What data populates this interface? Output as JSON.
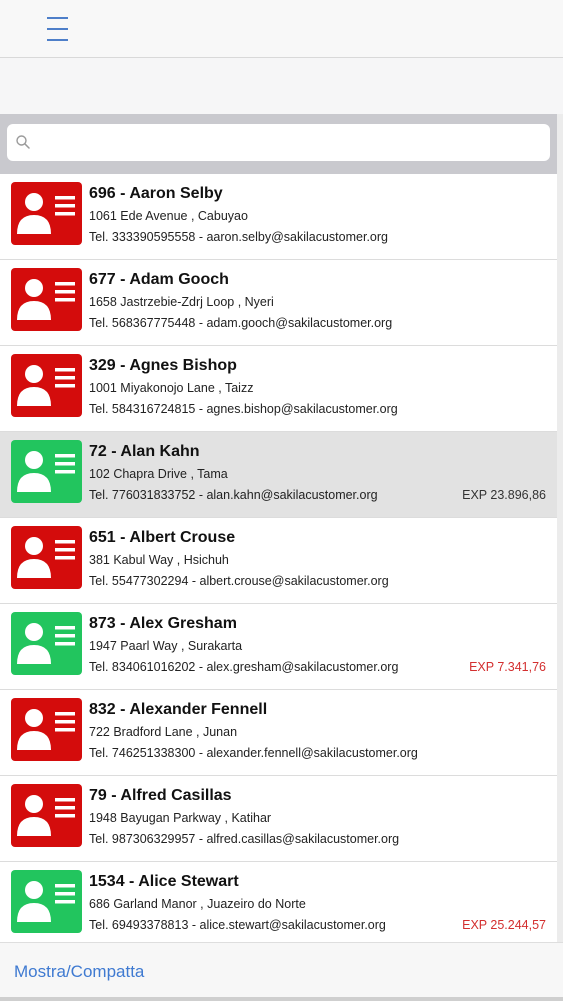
{
  "nav": {
    "menu_icon": "hamburger-menu-icon",
    "accent": "#4e7fc9"
  },
  "search": {
    "value": "",
    "placeholder": "",
    "icon": "search-icon"
  },
  "colors": {
    "badge_red": "#d40c0c",
    "badge_green": "#22c55e",
    "exp_gray": "#333333",
    "exp_red": "#d32f2f",
    "link_blue": "#3f7ad1"
  },
  "customers": [
    {
      "name": "696 - Aaron Selby",
      "address": "1061 Ede Avenue , Cabuyao",
      "contact": "Tel. 333390595558 - aaron.selby@sakilacustomer.org",
      "status": "red",
      "exp": "",
      "exp_color": "",
      "selected": false
    },
    {
      "name": "677 - Adam Gooch",
      "address": "1658 Jastrzebie-Zdrj Loop , Nyeri",
      "contact": "Tel. 568367775448 - adam.gooch@sakilacustomer.org",
      "status": "red",
      "exp": "",
      "exp_color": "",
      "selected": false
    },
    {
      "name": "329 - Agnes Bishop",
      "address": "1001 Miyakonojo Lane , Taizz",
      "contact": "Tel. 584316724815 - agnes.bishop@sakilacustomer.org",
      "status": "red",
      "exp": "",
      "exp_color": "",
      "selected": false
    },
    {
      "name": "72 - Alan Kahn",
      "address": "102 Chapra Drive , Tama",
      "contact": "Tel. 776031833752 - alan.kahn@sakilacustomer.org",
      "status": "green",
      "exp": "EXP 23.896,86",
      "exp_color": "#333333",
      "selected": true
    },
    {
      "name": "651 - Albert Crouse",
      "address": "381 Kabul Way , Hsichuh",
      "contact": "Tel. 55477302294 - albert.crouse@sakilacustomer.org",
      "status": "red",
      "exp": "",
      "exp_color": "",
      "selected": false
    },
    {
      "name": "873 - Alex Gresham",
      "address": "1947 Paarl Way , Surakarta",
      "contact": "Tel. 834061016202 - alex.gresham@sakilacustomer.org",
      "status": "green",
      "exp": "EXP 7.341,76",
      "exp_color": "#d32f2f",
      "selected": false
    },
    {
      "name": "832 - Alexander Fennell",
      "address": "722 Bradford Lane , Junan",
      "contact": "Tel. 746251338300 - alexander.fennell@sakilacustomer.org",
      "status": "red",
      "exp": "",
      "exp_color": "",
      "selected": false
    },
    {
      "name": "79 - Alfred Casillas",
      "address": "1948 Bayugan Parkway , Katihar",
      "contact": "Tel. 987306329957 - alfred.casillas@sakilacustomer.org",
      "status": "red",
      "exp": "",
      "exp_color": "",
      "selected": false
    },
    {
      "name": "1534 - Alice Stewart",
      "address": "686 Garland Manor , Juazeiro do Norte",
      "contact": "Tel. 69493378813 - alice.stewart@sakilacustomer.org",
      "status": "green",
      "exp": "EXP 25.244,57",
      "exp_color": "#d32f2f",
      "selected": false
    }
  ],
  "footer": {
    "toggle_label": "Mostra/Compatta"
  }
}
